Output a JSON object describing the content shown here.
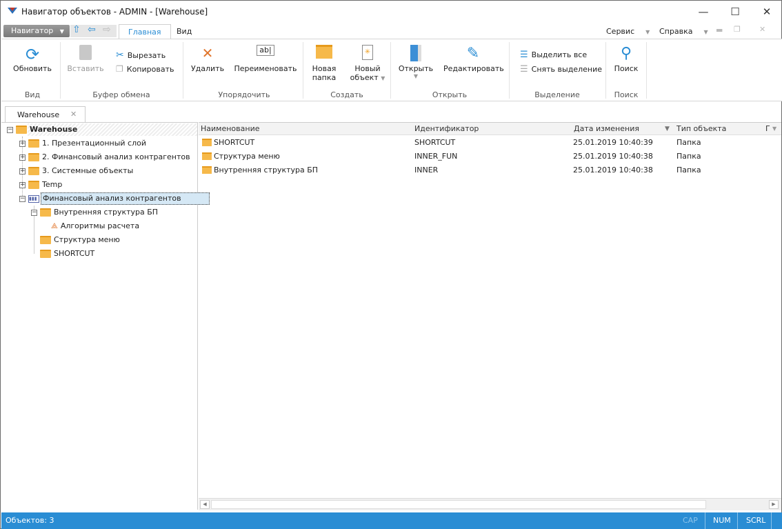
{
  "window": {
    "title": "Навигатор объектов - ADMIN - [Warehouse]",
    "minimize": "—",
    "maximize": "☐",
    "close": "✕"
  },
  "menu": {
    "navigator": "Навигатор",
    "tabs": [
      "Главная",
      "Вид"
    ],
    "service": "Сервис",
    "help": "Справка"
  },
  "ribbon": {
    "refresh": "Обновить",
    "group_view": "Вид",
    "paste": "Вставить",
    "cut": "Вырезать",
    "copy": "Копировать",
    "group_clipboard": "Буфер обмена",
    "delete": "Удалить",
    "rename": "Переименовать",
    "rename_icon_text": "ab|",
    "group_arrange": "Упорядочить",
    "new_folder": [
      "Новая",
      "папка"
    ],
    "new_object": [
      "Новый",
      "объект"
    ],
    "group_create": "Создать",
    "open": "Открыть",
    "edit": "Редактировать",
    "group_open": "Открыть",
    "select_all": "Выделить все",
    "deselect": "Снять выделение",
    "group_selection": "Выделение",
    "search": "Поиск",
    "group_search": "Поиск"
  },
  "doc_tab": {
    "label": "Warehouse"
  },
  "tree": {
    "root": "Warehouse",
    "items": [
      "1. Презентационный слой",
      "2. Финансовый анализ контрагентов",
      "3. Системные объекты",
      "Temp",
      "Финансовый анализ контрагентов",
      "Внутренняя структура БП",
      "Алгоритмы расчета",
      "Структура меню",
      "SHORTCUT"
    ]
  },
  "grid": {
    "columns": [
      "Наименование",
      "Идентификатор",
      "Дата изменения",
      "Тип объекта",
      "Г"
    ],
    "rows": [
      {
        "name": "SHORTCUT",
        "id": "SHORTCUT",
        "date": "25.01.2019 10:40:39",
        "type": "Папка"
      },
      {
        "name": "Структура меню",
        "id": "INNER_FUN",
        "date": "25.01.2019 10:40:38",
        "type": "Папка"
      },
      {
        "name": "Внутренняя структура БП",
        "id": "INNER",
        "date": "25.01.2019 10:40:38",
        "type": "Папка"
      }
    ]
  },
  "status": {
    "objects": "Объектов: 3",
    "cap": "CAP",
    "num": "NUM",
    "scrl": "SCRL"
  },
  "colors": {
    "accent": "#2a8dd4",
    "folder": "#f6b94a"
  }
}
